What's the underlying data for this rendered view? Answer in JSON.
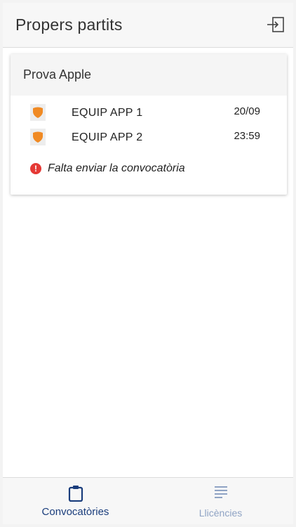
{
  "header": {
    "title": "Propers partits",
    "logout_icon": "logout-icon"
  },
  "match_card": {
    "title": "Prova Apple",
    "teams": [
      {
        "name": "EQUIP APP 1",
        "value": "20/09",
        "badge_icon": "shield-icon",
        "badge_color": "#f08a24"
      },
      {
        "name": "EQUIP APP 2",
        "value": "23:59",
        "badge_icon": "shield-icon",
        "badge_color": "#f08a24"
      }
    ],
    "warning": {
      "icon": "exclamation-circle-icon",
      "text": "Falta enviar la convocatòria",
      "color": "#e53935"
    }
  },
  "bottom_nav": {
    "items": [
      {
        "label": "Convocatòries",
        "icon": "clipboard-icon",
        "active": true,
        "color": "#1a3d7c"
      },
      {
        "label": "Llicències",
        "icon": "list-lines-icon",
        "active": false,
        "color": "#8fa3c4"
      }
    ]
  }
}
